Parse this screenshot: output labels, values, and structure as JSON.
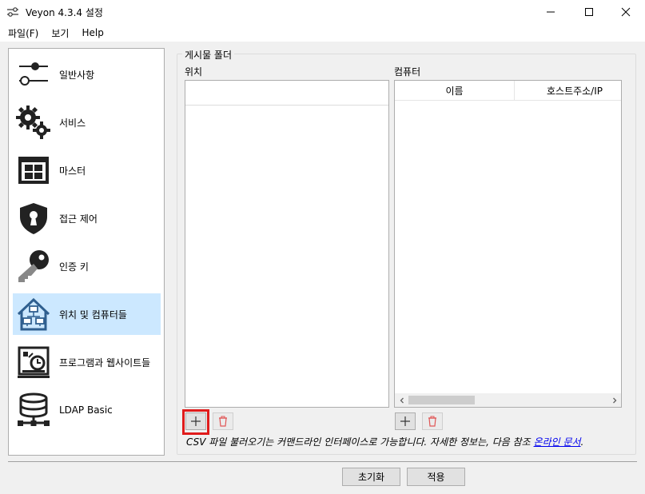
{
  "window": {
    "title": "Veyon  4.3.4 설정"
  },
  "menu": {
    "items": [
      "파일(F)",
      "보기",
      "Help"
    ]
  },
  "sidebar": {
    "items": [
      {
        "label": "일반사항",
        "icon": "sliders-icon"
      },
      {
        "label": "서비스",
        "icon": "gears-icon"
      },
      {
        "label": "마스터",
        "icon": "grid-window-icon"
      },
      {
        "label": "접근 제어",
        "icon": "shield-keyhole-icon"
      },
      {
        "label": "인증 키",
        "icon": "key-icon"
      },
      {
        "label": "위치 및 컴퓨터들",
        "icon": "house-network-icon",
        "selected": true
      },
      {
        "label": "프로그램과 웹사이트들",
        "icon": "clock-document-icon"
      },
      {
        "label": "LDAP Basic",
        "icon": "database-network-icon"
      }
    ]
  },
  "main": {
    "group_title": "게시물 폴더",
    "locations_label": "위치",
    "computers_label": "컴퓨터",
    "computers_columns": [
      "이름",
      "호스트주소/IP"
    ],
    "info_text": "CSV 파일 불러오기는 커맨드라인 인터페이스로 가능합니다. 자세한 정보는, 다음 참조 ",
    "info_link": "온라인 문서",
    "info_end": "."
  },
  "buttons": {
    "reset": "초기화",
    "apply": "적용"
  },
  "colors": {
    "selection": "#cce8ff",
    "highlight": "#e01c1c",
    "link": "#0000ee",
    "icon_dark": "#222222",
    "icon_blue": "#2f5f8f",
    "delete_red": "#e05555"
  }
}
